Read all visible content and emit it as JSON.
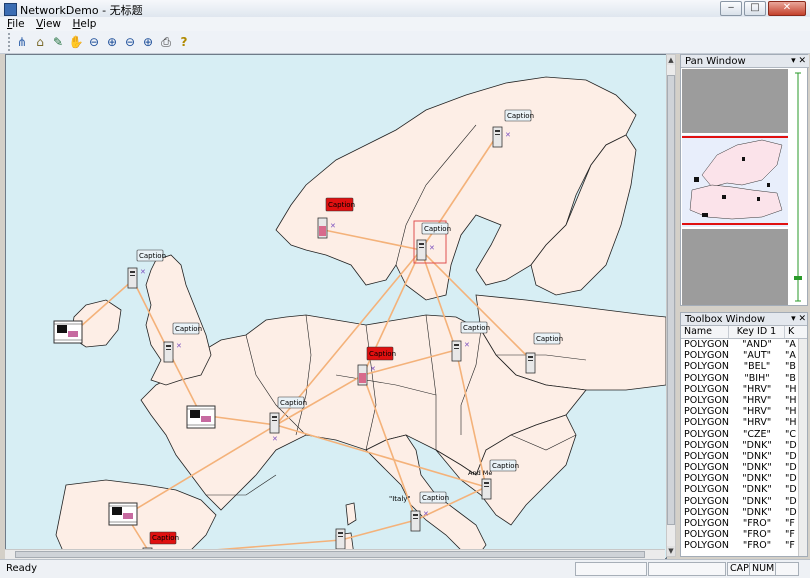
{
  "window": {
    "title": "NetworkDemo - 无标题"
  },
  "menu": [
    {
      "label": "File",
      "u": "F",
      "rest": "ile"
    },
    {
      "label": "View",
      "u": "V",
      "rest": "iew"
    },
    {
      "label": "Help",
      "u": "H",
      "rest": "elp"
    }
  ],
  "toolbar": [
    {
      "name": "network-tool",
      "glyph": "⋔"
    },
    {
      "name": "pointer-tool",
      "glyph": "⌂"
    },
    {
      "name": "select-tool",
      "glyph": "✎"
    },
    {
      "name": "pan-hand-tool",
      "glyph": "✋"
    },
    {
      "name": "zoom-out-tool",
      "glyph": "⊖"
    },
    {
      "name": "zoom-in-tool",
      "glyph": "⊕"
    },
    {
      "name": "zoom-out-2-tool",
      "glyph": "⊖"
    },
    {
      "name": "zoom-all-tool",
      "glyph": "⊕"
    },
    {
      "name": "print-tool",
      "glyph": "⎙"
    },
    {
      "name": "help-tool",
      "glyph": "?"
    }
  ],
  "map": {
    "caption_label": "Caption",
    "place_labels": {
      "italy": "\"Italy\"",
      "and_me": "And Me"
    }
  },
  "pan_window": {
    "title": "Pan Window"
  },
  "toolbox": {
    "title": "Toolbox Window",
    "columns": [
      "Name",
      "Key ID 1",
      "K"
    ],
    "rows": [
      {
        "name": "POLYGON",
        "key": "\"AND\"",
        "k": "\"A"
      },
      {
        "name": "POLYGON",
        "key": "\"AUT\"",
        "k": "\"A"
      },
      {
        "name": "POLYGON",
        "key": "\"BEL\"",
        "k": "\"B"
      },
      {
        "name": "POLYGON",
        "key": "\"BIH\"",
        "k": "\"B"
      },
      {
        "name": "POLYGON",
        "key": "\"HRV\"",
        "k": "\"H"
      },
      {
        "name": "POLYGON",
        "key": "\"HRV\"",
        "k": "\"H"
      },
      {
        "name": "POLYGON",
        "key": "\"HRV\"",
        "k": "\"H"
      },
      {
        "name": "POLYGON",
        "key": "\"HRV\"",
        "k": "\"H"
      },
      {
        "name": "POLYGON",
        "key": "\"CZE\"",
        "k": "\"C"
      },
      {
        "name": "POLYGON",
        "key": "\"DNK\"",
        "k": "\"D"
      },
      {
        "name": "POLYGON",
        "key": "\"DNK\"",
        "k": "\"D"
      },
      {
        "name": "POLYGON",
        "key": "\"DNK\"",
        "k": "\"D"
      },
      {
        "name": "POLYGON",
        "key": "\"DNK\"",
        "k": "\"D"
      },
      {
        "name": "POLYGON",
        "key": "\"DNK\"",
        "k": "\"D"
      },
      {
        "name": "POLYGON",
        "key": "\"DNK\"",
        "k": "\"D"
      },
      {
        "name": "POLYGON",
        "key": "\"DNK\"",
        "k": "\"D"
      },
      {
        "name": "POLYGON",
        "key": "\"FRO\"",
        "k": "\"F"
      },
      {
        "name": "POLYGON",
        "key": "\"FRO\"",
        "k": "\"F"
      },
      {
        "name": "POLYGON",
        "key": "\"FRO\"",
        "k": "\"F"
      }
    ]
  },
  "status": {
    "text": "Ready",
    "cap": "CAP",
    "num": "NUM"
  },
  "colors": {
    "land": "#fdeee6",
    "sea": "#d7eef4",
    "link": "#f4b27a",
    "caption_alert": "#e01010"
  }
}
